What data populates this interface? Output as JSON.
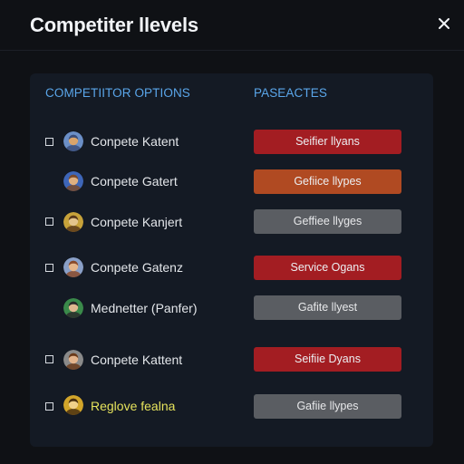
{
  "dialog": {
    "title": "Competiter llevels",
    "close_label": "✕"
  },
  "columns": {
    "left": "COMPETIITOR OPTIONS",
    "right": "PASEACTES"
  },
  "rows": [
    {
      "name": "Conpete Katent",
      "checkbox": true,
      "status": "Seifier llyans",
      "status_color": "#a31d22",
      "avatar_colors": [
        "#6b8fc7",
        "#d9a46b",
        "#3a4d7a"
      ],
      "highlight": false
    },
    {
      "name": "Conpete Gatert",
      "checkbox": false,
      "status": "Gefiice llypes",
      "status_color": "#b04a22",
      "avatar_colors": [
        "#3e66b8",
        "#e0b080",
        "#7a4a2a"
      ],
      "highlight": false
    },
    {
      "name": "Conpete Kanjert",
      "checkbox": true,
      "status": "Geffiee llyges",
      "status_color": "#5a5d62",
      "avatar_colors": [
        "#c7a23a",
        "#e3c48c",
        "#5a3a1a"
      ],
      "highlight": false
    },
    {
      "name": "Conpete Gatenz",
      "checkbox": true,
      "status": "Service Ogans",
      "status_color": "#a31d22",
      "avatar_colors": [
        "#8aa0c8",
        "#e6b68a",
        "#8a4a2a"
      ],
      "highlight": false
    },
    {
      "name": "Mednetter (Panfer)",
      "checkbox": false,
      "status": "Gafite llyest",
      "status_color": "#5a5d62",
      "avatar_colors": [
        "#3a8a4a",
        "#e0b890",
        "#2a2a2a"
      ],
      "highlight": false
    },
    {
      "name": "Conpete Kattent",
      "checkbox": true,
      "status": "Seifiie Dyans",
      "status_color": "#a31d22",
      "avatar_colors": [
        "#8a8a8a",
        "#e4b48c",
        "#6a3a1a"
      ],
      "highlight": false
    },
    {
      "name": "Reglove fealna",
      "checkbox": true,
      "status": "Gafiie llypes",
      "status_color": "#5a5d62",
      "avatar_colors": [
        "#d2a52a",
        "#f0d08a",
        "#4a3010"
      ],
      "highlight": true
    }
  ],
  "colors": {
    "accent": "#5aa6ea",
    "red": "#a31d22",
    "orange": "#b04a22",
    "gray": "#5a5d62",
    "highlight_text": "#e6e35c"
  }
}
